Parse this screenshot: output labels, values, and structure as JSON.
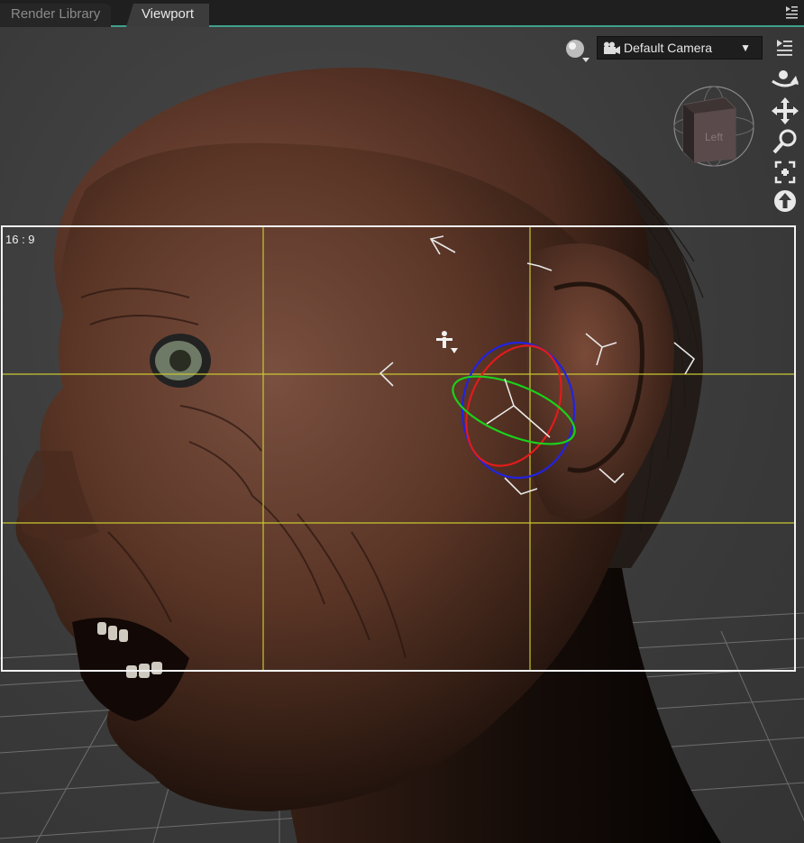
{
  "tabs": [
    {
      "label": "Render Library",
      "active": false
    },
    {
      "label": "Viewport",
      "active": true
    }
  ],
  "viewport": {
    "camera_label": "Default Camera",
    "aspect_ratio": "16 : 9",
    "navcube_face": "Left",
    "tools": [
      "orbit-icon",
      "pan-icon",
      "zoom-icon",
      "frame-icon",
      "reset-view-icon"
    ]
  },
  "colors": {
    "accent": "#3fa08c",
    "frame": "#f2f2f2",
    "guides": "#c8c832",
    "gizmo_x": "#e11b1b",
    "gizmo_y": "#1bd11b",
    "gizmo_z": "#2222e0"
  }
}
